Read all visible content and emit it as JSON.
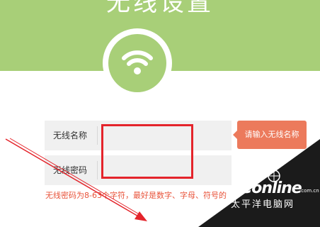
{
  "header": {
    "title": "无线设置"
  },
  "colors": {
    "brand_green": "#a8cf78",
    "hint_orange": "#ec7a5c",
    "annotation_red": "#e4242b",
    "error_text": "#e8533a"
  },
  "icons": {
    "wifi": "wifi-icon"
  },
  "form": {
    "ssid": {
      "label": "无线名称",
      "value": ""
    },
    "password": {
      "label": "无线密码",
      "value": ""
    },
    "ssid_error": "请输入无线名称",
    "password_rule": "无线密码为8-63个字符，最好是数字、字母、符号的"
  },
  "watermark": {
    "logo": "PConline",
    "domain": ".com.cn",
    "subtitle": "太平洋电脑网"
  }
}
